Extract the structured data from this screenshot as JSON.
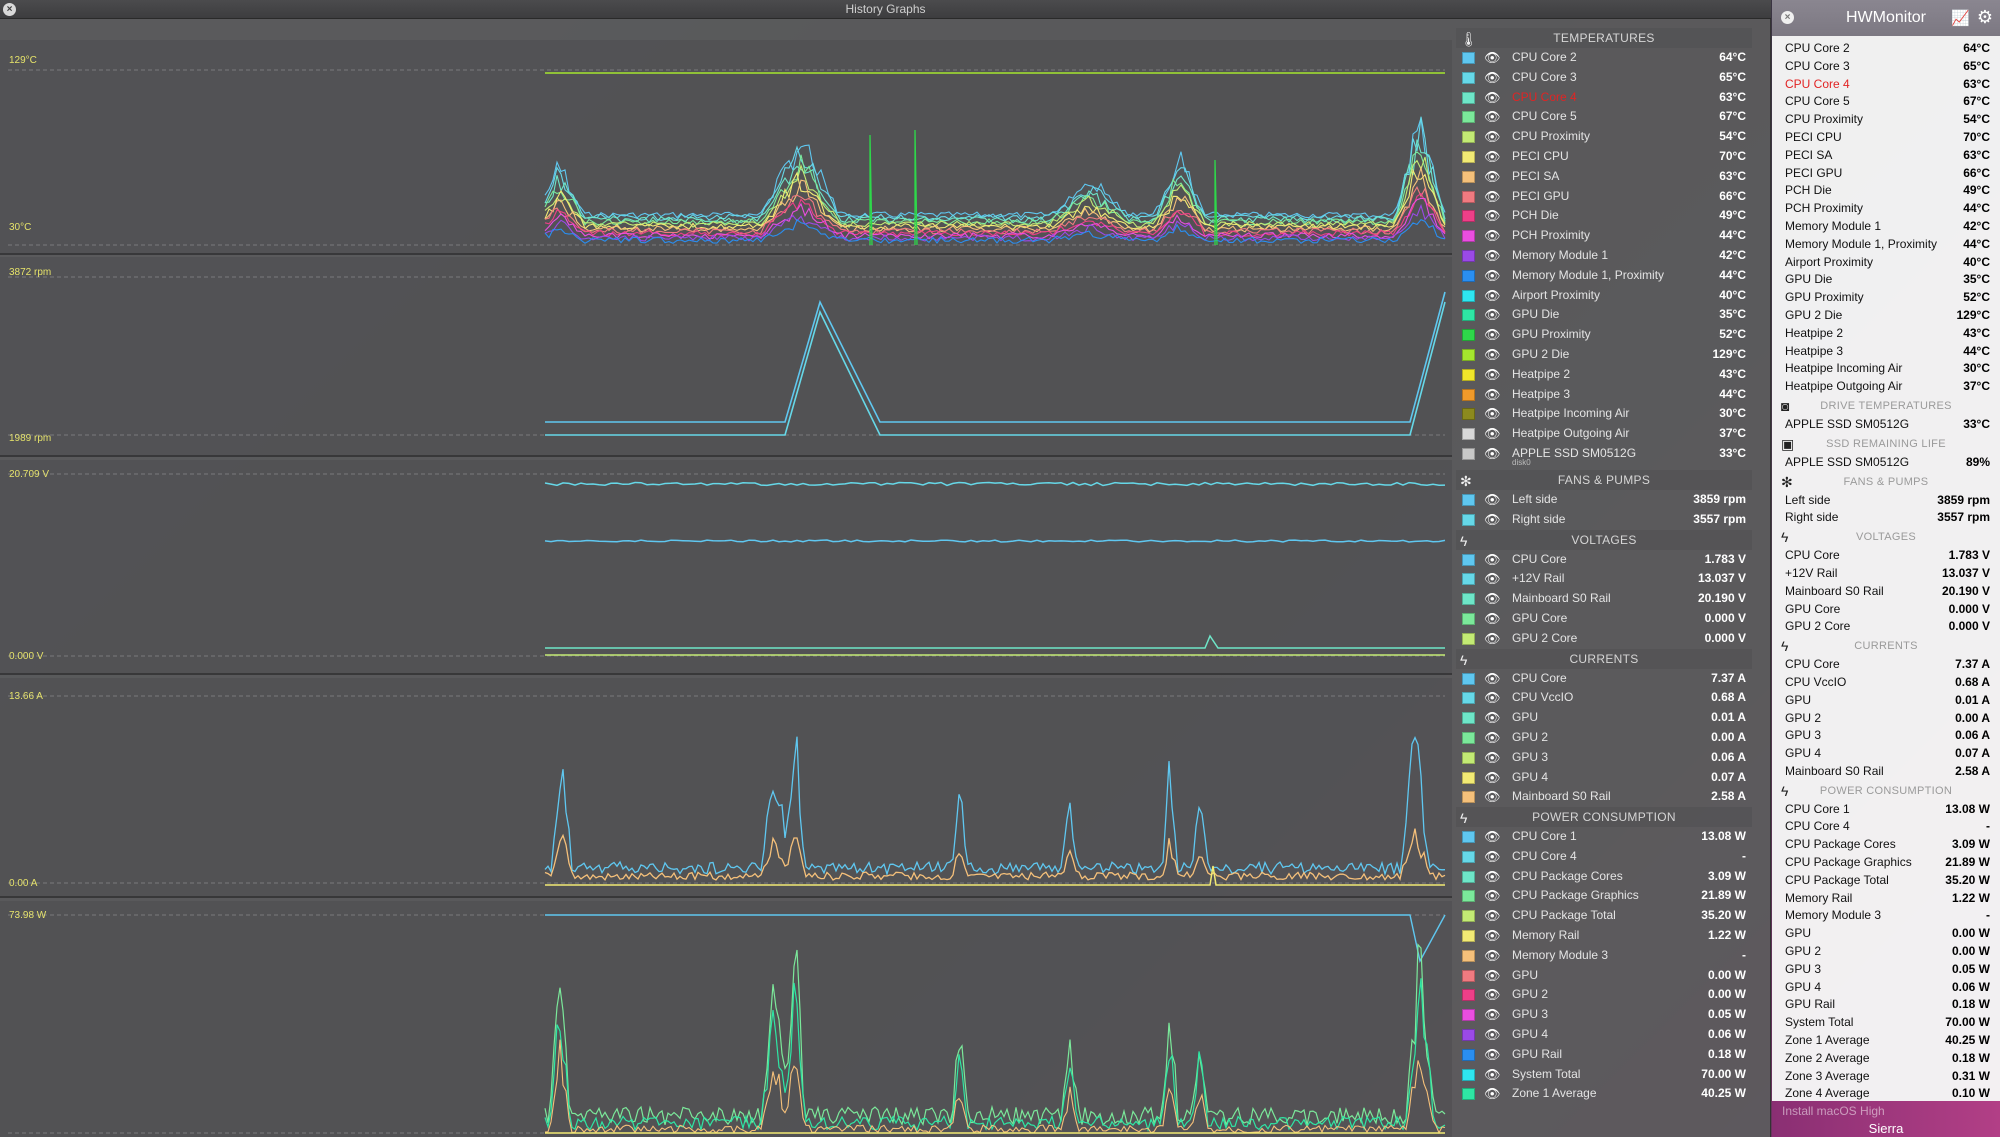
{
  "history_window": {
    "title": "History Graphs",
    "close_glyph": "×",
    "graph_labels": [
      {
        "max": "129°C",
        "min": "30°C"
      },
      {
        "max": "3872 rpm",
        "min": "1989 rpm"
      },
      {
        "max": "20.709 V",
        "min": "0.000 V"
      },
      {
        "max": "13.66 A",
        "min": "0.00 A"
      },
      {
        "max": "73.98 W",
        "min": ""
      }
    ]
  },
  "legend": {
    "sections": [
      {
        "title": "TEMPERATURES",
        "icon": "thermometer-icon",
        "glyph": "🌡",
        "rows": [
          {
            "name": "CPU Core 2",
            "value": "64°C",
            "color": "#5fc7f0"
          },
          {
            "name": "CPU Core 3",
            "value": "65°C",
            "color": "#66d8e8"
          },
          {
            "name": "CPU Core 4",
            "value": "63°C",
            "color": "#6ee6c8",
            "alert": true
          },
          {
            "name": "CPU Core 5",
            "value": "67°C",
            "color": "#7be89a"
          },
          {
            "name": "CPU Proximity",
            "value": "54°C",
            "color": "#c3ea74"
          },
          {
            "name": "PECI CPU",
            "value": "70°C",
            "color": "#f2ea74"
          },
          {
            "name": "PECI SA",
            "value": "63°C",
            "color": "#f5c07a"
          },
          {
            "name": "PECI GPU",
            "value": "66°C",
            "color": "#f07a80"
          },
          {
            "name": "PCH Die",
            "value": "49°C",
            "color": "#ee3f88"
          },
          {
            "name": "PCH Proximity",
            "value": "44°C",
            "color": "#ea4ee0"
          },
          {
            "name": "Memory Module 1",
            "value": "42°C",
            "color": "#9a4ae6"
          },
          {
            "name": "Memory Module 1, Proximity",
            "value": "44°C",
            "color": "#2a8ef0"
          },
          {
            "name": "Airport Proximity",
            "value": "40°C",
            "color": "#2ee6f0"
          },
          {
            "name": "GPU Die",
            "value": "35°C",
            "color": "#2ee6a4"
          },
          {
            "name": "GPU Proximity",
            "value": "52°C",
            "color": "#2ed84a"
          },
          {
            "name": "GPU 2 Die",
            "value": "129°C",
            "color": "#a4e62e"
          },
          {
            "name": "Heatpipe 2",
            "value": "43°C",
            "color": "#f0e62a"
          },
          {
            "name": "Heatpipe 3",
            "value": "44°C",
            "color": "#f09a2a"
          },
          {
            "name": "Heatpipe Incoming Air",
            "value": "30°C",
            "color": "#8c8a1e"
          },
          {
            "name": "Heatpipe Outgoing Air",
            "value": "37°C",
            "color": "#d8d8d8"
          },
          {
            "name": "APPLE SSD SM0512G",
            "value": "33°C",
            "color": "#c8c8c8",
            "sub": "disk0"
          }
        ]
      },
      {
        "title": "FANS & PUMPS",
        "icon": "fan-icon",
        "glyph": "✻",
        "rows": [
          {
            "name": "Left side",
            "value": "3859 rpm",
            "color": "#5fc7f0"
          },
          {
            "name": "Right side",
            "value": "3557 rpm",
            "color": "#66d8e8"
          }
        ]
      },
      {
        "title": "VOLTAGES",
        "icon": "lightning-icon",
        "glyph": "ϟ",
        "rows": [
          {
            "name": "CPU Core",
            "value": "1.783 V",
            "color": "#5fc7f0"
          },
          {
            "name": "+12V Rail",
            "value": "13.037 V",
            "color": "#66d8e8"
          },
          {
            "name": "Mainboard S0 Rail",
            "value": "20.190 V",
            "color": "#6ee6c8"
          },
          {
            "name": "GPU Core",
            "value": "0.000 V",
            "color": "#7be89a"
          },
          {
            "name": "GPU 2 Core",
            "value": "0.000 V",
            "color": "#c3ea74"
          }
        ]
      },
      {
        "title": "CURRENTS",
        "icon": "lightning-icon",
        "glyph": "ϟ",
        "rows": [
          {
            "name": "CPU Core",
            "value": "7.37 A",
            "color": "#5fc7f0"
          },
          {
            "name": "CPU VccIO",
            "value": "0.68 A",
            "color": "#66d8e8"
          },
          {
            "name": "GPU",
            "value": "0.01 A",
            "color": "#6ee6c8"
          },
          {
            "name": "GPU 2",
            "value": "0.00 A",
            "color": "#7be89a"
          },
          {
            "name": "GPU 3",
            "value": "0.06 A",
            "color": "#c3ea74"
          },
          {
            "name": "GPU 4",
            "value": "0.07 A",
            "color": "#f2ea74"
          },
          {
            "name": "Mainboard S0 Rail",
            "value": "2.58 A",
            "color": "#f5c07a"
          }
        ]
      },
      {
        "title": "POWER CONSUMPTION",
        "icon": "lightning-icon",
        "glyph": "ϟ",
        "rows": [
          {
            "name": "CPU Core 1",
            "value": "13.08 W",
            "color": "#5fc7f0"
          },
          {
            "name": "CPU Core 4",
            "value": "-",
            "color": "#66d8e8"
          },
          {
            "name": "CPU Package Cores",
            "value": "3.09 W",
            "color": "#6ee6c8"
          },
          {
            "name": "CPU Package Graphics",
            "value": "21.89 W",
            "color": "#7be89a"
          },
          {
            "name": "CPU Package Total",
            "value": "35.20 W",
            "color": "#c3ea74"
          },
          {
            "name": "Memory Rail",
            "value": "1.22 W",
            "color": "#f2ea74"
          },
          {
            "name": "Memory Module 3",
            "value": "-",
            "color": "#f5c07a"
          },
          {
            "name": "GPU",
            "value": "0.00 W",
            "color": "#f07a80"
          },
          {
            "name": "GPU 2",
            "value": "0.00 W",
            "color": "#ee3f88"
          },
          {
            "name": "GPU 3",
            "value": "0.05 W",
            "color": "#ea4ee0"
          },
          {
            "name": "GPU 4",
            "value": "0.06 W",
            "color": "#9a4ae6"
          },
          {
            "name": "GPU Rail",
            "value": "0.18 W",
            "color": "#2a8ef0"
          },
          {
            "name": "System Total",
            "value": "70.00 W",
            "color": "#2ee6f0"
          },
          {
            "name": "Zone 1 Average",
            "value": "40.25 W",
            "color": "#2ee6a4"
          }
        ]
      }
    ]
  },
  "hwmonitor": {
    "title": "HWMonitor",
    "close_glyph": "×",
    "footer_faded": "Install macOS High",
    "footer_text": "Sierra",
    "sections": [
      {
        "title": "",
        "icon": "",
        "glyph": "",
        "rows": [
          {
            "name": "CPU Core 2",
            "value": "64°C"
          },
          {
            "name": "CPU Core 3",
            "value": "65°C"
          },
          {
            "name": "CPU Core 4",
            "value": "63°C",
            "alert": true
          },
          {
            "name": "CPU Core 5",
            "value": "67°C"
          },
          {
            "name": "CPU Proximity",
            "value": "54°C"
          },
          {
            "name": "PECI CPU",
            "value": "70°C"
          },
          {
            "name": "PECI SA",
            "value": "63°C"
          },
          {
            "name": "PECI GPU",
            "value": "66°C"
          },
          {
            "name": "PCH Die",
            "value": "49°C"
          },
          {
            "name": "PCH Proximity",
            "value": "44°C"
          },
          {
            "name": "Memory Module 1",
            "value": "42°C"
          },
          {
            "name": "Memory Module 1, Proximity",
            "value": "44°C"
          },
          {
            "name": "Airport Proximity",
            "value": "40°C"
          },
          {
            "name": "GPU Die",
            "value": "35°C"
          },
          {
            "name": "GPU Proximity",
            "value": "52°C"
          },
          {
            "name": "GPU 2 Die",
            "value": "129°C"
          },
          {
            "name": "Heatpipe 2",
            "value": "43°C"
          },
          {
            "name": "Heatpipe 3",
            "value": "44°C"
          },
          {
            "name": "Heatpipe Incoming Air",
            "value": "30°C"
          },
          {
            "name": "Heatpipe Outgoing Air",
            "value": "37°C"
          }
        ]
      },
      {
        "title": "DRIVE TEMPERATURES",
        "icon": "drive-icon",
        "glyph": "◙",
        "rows": [
          {
            "name": "APPLE SSD SM0512G",
            "value": "33°C"
          }
        ]
      },
      {
        "title": "SSD REMAINING LIFE",
        "icon": "ssd-icon",
        "glyph": "▣",
        "rows": [
          {
            "name": "APPLE SSD SM0512G",
            "value": "89%"
          }
        ]
      },
      {
        "title": "FANS & PUMPS",
        "icon": "fan-icon",
        "glyph": "✻",
        "rows": [
          {
            "name": "Left side",
            "value": "3859 rpm"
          },
          {
            "name": "Right side",
            "value": "3557 rpm"
          }
        ]
      },
      {
        "title": "VOLTAGES",
        "icon": "lightning-icon",
        "glyph": "ϟ",
        "rows": [
          {
            "name": "CPU Core",
            "value": "1.783 V"
          },
          {
            "name": "+12V Rail",
            "value": "13.037 V"
          },
          {
            "name": "Mainboard S0 Rail",
            "value": "20.190 V"
          },
          {
            "name": "GPU Core",
            "value": "0.000 V"
          },
          {
            "name": "GPU 2 Core",
            "value": "0.000 V"
          }
        ]
      },
      {
        "title": "CURRENTS",
        "icon": "lightning-icon",
        "glyph": "ϟ",
        "rows": [
          {
            "name": "CPU Core",
            "value": "7.37 A"
          },
          {
            "name": "CPU VccIO",
            "value": "0.68 A"
          },
          {
            "name": "GPU",
            "value": "0.01 A"
          },
          {
            "name": "GPU 2",
            "value": "0.00 A"
          },
          {
            "name": "GPU 3",
            "value": "0.06 A"
          },
          {
            "name": "GPU 4",
            "value": "0.07 A"
          },
          {
            "name": "Mainboard S0 Rail",
            "value": "2.58 A"
          }
        ]
      },
      {
        "title": "POWER CONSUMPTION",
        "icon": "lightning-icon",
        "glyph": "ϟ",
        "rows": [
          {
            "name": "CPU Core 1",
            "value": "13.08 W"
          },
          {
            "name": "CPU Core 4",
            "value": "-"
          },
          {
            "name": "CPU Package Cores",
            "value": "3.09 W"
          },
          {
            "name": "CPU Package Graphics",
            "value": "21.89 W"
          },
          {
            "name": "CPU Package Total",
            "value": "35.20 W"
          },
          {
            "name": "Memory Rail",
            "value": "1.22 W"
          },
          {
            "name": "Memory Module 3",
            "value": "-"
          },
          {
            "name": "GPU",
            "value": "0.00 W"
          },
          {
            "name": "GPU 2",
            "value": "0.00 W"
          },
          {
            "name": "GPU 3",
            "value": "0.05 W"
          },
          {
            "name": "GPU 4",
            "value": "0.06 W"
          },
          {
            "name": "GPU Rail",
            "value": "0.18 W"
          },
          {
            "name": "System Total",
            "value": "70.00 W"
          },
          {
            "name": "Zone 1 Average",
            "value": "40.25 W"
          },
          {
            "name": "Zone 2 Average",
            "value": "0.18 W"
          },
          {
            "name": "Zone 3 Average",
            "value": "0.31 W"
          },
          {
            "name": "Zone 4 Average",
            "value": "0.10 W"
          }
        ]
      }
    ]
  },
  "colors": {
    "accent_label": "#e6e36a",
    "alert": "#e12424"
  }
}
